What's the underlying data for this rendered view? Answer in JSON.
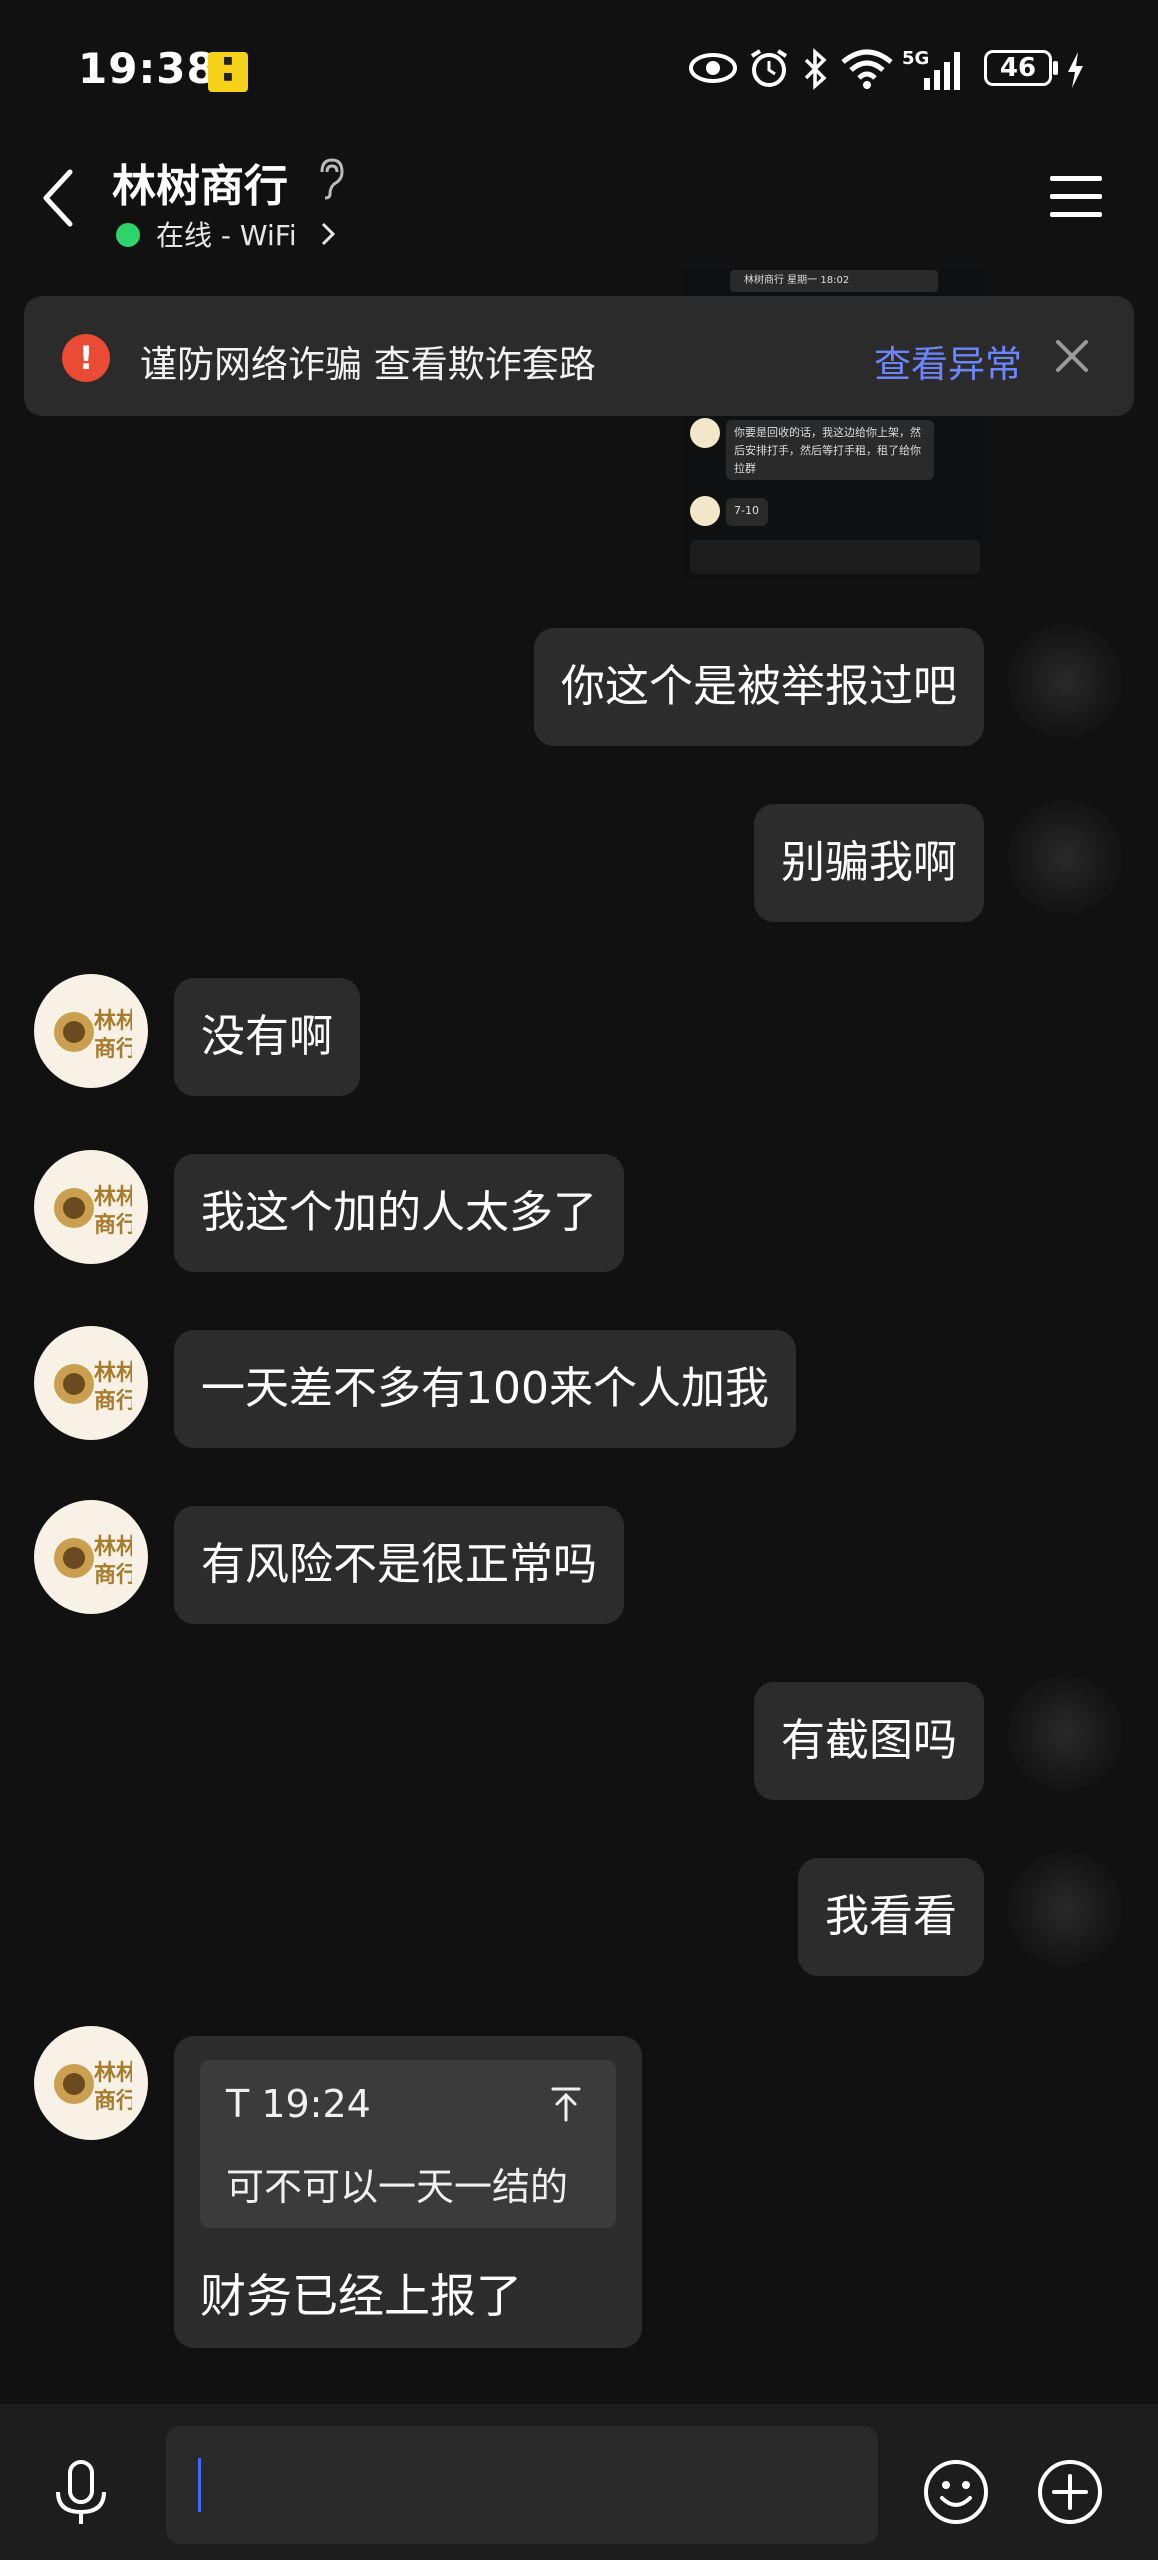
{
  "status_bar": {
    "time": "19:38",
    "network": "5G",
    "battery": "46",
    "icons": [
      "app-badge-icon",
      "eye-icon",
      "alarm-icon",
      "bluetooth-icon",
      "wifi-icon",
      "signal-icon",
      "battery-icon",
      "charging-icon"
    ]
  },
  "header": {
    "title": "林树商行",
    "status_text": "在线 - WiFi",
    "status_color": "#2fd36b"
  },
  "warning_banner": {
    "text": "谨防网络诈骗 查看欺诈套路",
    "link": "查看异常",
    "accent": "#e94b35",
    "link_color": "#6d86ff"
  },
  "thumbnail": {
    "header": "林树商行 星期一 18:02",
    "msg1": "你要是回收的话，我这边给你上架，然后安排打手，然后等打手租，租了给你拉群",
    "msg2": "7-10"
  },
  "messages": [
    {
      "side": "right",
      "text": "你这个是被举报过吧"
    },
    {
      "side": "right",
      "text": "别骗我啊"
    },
    {
      "side": "left",
      "text": "没有啊"
    },
    {
      "side": "left",
      "text": "我这个加的人太多了"
    },
    {
      "side": "left",
      "text": "一天差不多有100来个人加我"
    },
    {
      "side": "left",
      "text": "有风险不是很正常吗"
    },
    {
      "side": "right",
      "text": "有截图吗"
    },
    {
      "side": "right",
      "text": "我看看"
    }
  ],
  "reply_message": {
    "quote_sender": "T",
    "quote_time": "19:24",
    "quote_text": "可不可以一天一结的",
    "text": "财务已经上报了"
  },
  "avatar_text": "林林\n商行"
}
